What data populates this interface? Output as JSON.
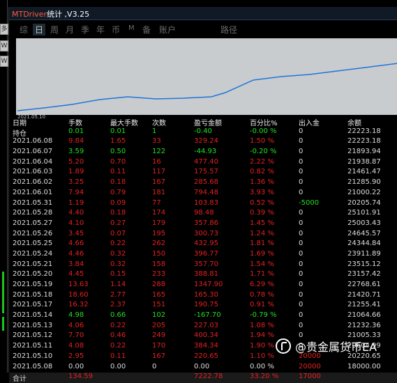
{
  "window": {
    "title_prefix": "MTDriver",
    "title_suffix": "统计 ,V3.25"
  },
  "left_strip": {
    "buttons": [
      "多",
      "W",
      "W",
      "?"
    ]
  },
  "tabs": [
    {
      "label": "综",
      "active": false
    },
    {
      "label": "日",
      "active": true
    },
    {
      "label": "周",
      "active": false
    },
    {
      "label": "月",
      "active": false
    },
    {
      "label": "季",
      "active": false
    },
    {
      "label": "年",
      "active": false
    },
    {
      "label": "币",
      "active": false
    },
    {
      "label": "M",
      "active": false
    },
    {
      "label": "备",
      "active": false
    },
    {
      "label": "账户",
      "active": false
    },
    {
      "label": "路径",
      "active": false
    }
  ],
  "equity_chart": {
    "start_label": "2021.05.10",
    "line_color": "#1e74d8",
    "background": "#c9cccf"
  },
  "table": {
    "headers": {
      "date": "日期",
      "lots": "手数",
      "max_lots": "最大手数",
      "count": "次数",
      "pl": "盈亏金额",
      "pct": "百分比%",
      "io": "出入金",
      "balance": "余额"
    },
    "holding": {
      "date": "持仓",
      "lots": "0.01",
      "max_lots": "0.01",
      "count": "1",
      "pl": "-0.40",
      "pct": "-0.00 %",
      "io": "0",
      "balance": "22223.18"
    },
    "rows": [
      {
        "date": "2021.06.08",
        "lots": "9.84",
        "max_lots": "1.65",
        "count": "33",
        "pl": "329.24",
        "pct": "1.50 %",
        "io": "0",
        "balance": "22223.18",
        "tone": "red"
      },
      {
        "date": "2021.06.07",
        "lots": "3.59",
        "max_lots": "0.50",
        "count": "122",
        "pl": "-44.93",
        "pct": "-0.20 %",
        "io": "0",
        "balance": "21893.94",
        "tone": "green"
      },
      {
        "date": "2021.06.04",
        "lots": "5.20",
        "max_lots": "0.70",
        "count": "16",
        "pl": "477.40",
        "pct": "2.22 %",
        "io": "0",
        "balance": "21938.87",
        "tone": "red"
      },
      {
        "date": "2021.06.03",
        "lots": "1.89",
        "max_lots": "0.11",
        "count": "117",
        "pl": "175.57",
        "pct": "0.82 %",
        "io": "0",
        "balance": "21461.47",
        "tone": "red"
      },
      {
        "date": "2021.06.02",
        "lots": "3.25",
        "max_lots": "0.18",
        "count": "167",
        "pl": "285.68",
        "pct": "1.36 %",
        "io": "0",
        "balance": "21285.90",
        "tone": "red"
      },
      {
        "date": "2021.06.01",
        "lots": "7.94",
        "max_lots": "0.79",
        "count": "181",
        "pl": "794.48",
        "pct": "3.93 %",
        "io": "0",
        "balance": "21000.22",
        "tone": "red"
      },
      {
        "date": "2021.05.31",
        "lots": "1.19",
        "max_lots": "0.09",
        "count": "77",
        "pl": "103.83",
        "pct": "0.52 %",
        "io": "-5000",
        "balance": "20205.74",
        "tone": "red",
        "io_tone": "green"
      },
      {
        "date": "2021.05.28",
        "lots": "4.40",
        "max_lots": "0.18",
        "count": "174",
        "pl": "98.48",
        "pct": "0.39 %",
        "io": "0",
        "balance": "25101.91",
        "tone": "red"
      },
      {
        "date": "2021.05.27",
        "lots": "4.10",
        "max_lots": "0.27",
        "count": "179",
        "pl": "357.86",
        "pct": "1.45 %",
        "io": "0",
        "balance": "25003.43",
        "tone": "red"
      },
      {
        "date": "2021.05.26",
        "lots": "3.45",
        "max_lots": "0.07",
        "count": "195",
        "pl": "300.73",
        "pct": "1.24 %",
        "io": "0",
        "balance": "24645.57",
        "tone": "red"
      },
      {
        "date": "2021.05.25",
        "lots": "4.66",
        "max_lots": "0.22",
        "count": "262",
        "pl": "432.95",
        "pct": "1.81 %",
        "io": "0",
        "balance": "24344.84",
        "tone": "red"
      },
      {
        "date": "2021.05.24",
        "lots": "4.46",
        "max_lots": "0.32",
        "count": "150",
        "pl": "396.77",
        "pct": "1.69 %",
        "io": "0",
        "balance": "23911.89",
        "tone": "red"
      },
      {
        "date": "2021.05.21",
        "lots": "3.84",
        "max_lots": "0.32",
        "count": "158",
        "pl": "357.70",
        "pct": "1.54 %",
        "io": "0",
        "balance": "23515.12",
        "tone": "red"
      },
      {
        "date": "2021.05.20",
        "lots": "4.45",
        "max_lots": "0.15",
        "count": "233",
        "pl": "388.81",
        "pct": "1.71 %",
        "io": "0",
        "balance": "23157.42",
        "tone": "red"
      },
      {
        "date": "2021.05.19",
        "lots": "13.63",
        "max_lots": "1.14",
        "count": "288",
        "pl": "1347.90",
        "pct": "6.29 %",
        "io": "0",
        "balance": "22768.61",
        "tone": "red"
      },
      {
        "date": "2021.05.18",
        "lots": "18.60",
        "max_lots": "2.77",
        "count": "165",
        "pl": "165.30",
        "pct": "0.78 %",
        "io": "0",
        "balance": "21420.71",
        "tone": "red"
      },
      {
        "date": "2021.05.17",
        "lots": "16.32",
        "max_lots": "2.37",
        "count": "151",
        "pl": "190.75",
        "pct": "0.91 %",
        "io": "0",
        "balance": "21255.41",
        "tone": "red"
      },
      {
        "date": "2021.05.14",
        "lots": "4.98",
        "max_lots": "0.66",
        "count": "102",
        "pl": "-167.70",
        "pct": "-0.79 %",
        "io": "0",
        "balance": "21064.66",
        "tone": "green"
      },
      {
        "date": "2021.05.13",
        "lots": "4.06",
        "max_lots": "0.22",
        "count": "205",
        "pl": "227.03",
        "pct": "1.08 %",
        "io": "0",
        "balance": "21232.36",
        "tone": "red"
      },
      {
        "date": "2021.05.12",
        "lots": "7.70",
        "max_lots": "0.46",
        "count": "249",
        "pl": "400.34",
        "pct": "1.94 %",
        "io": "0",
        "balance": "21005.33",
        "tone": "red"
      },
      {
        "date": "2021.05.11",
        "lots": "4.08",
        "max_lots": "0.22",
        "count": "170",
        "pl": "384.34",
        "pct": "1.90 %",
        "io": "0",
        "balance": "20604.99",
        "tone": "red"
      },
      {
        "date": "2021.05.10",
        "lots": "2.95",
        "max_lots": "0.11",
        "count": "167",
        "pl": "220.65",
        "pct": "1.10 %",
        "io": "20000",
        "balance": "20220.65",
        "tone": "red",
        "io_tone": "red"
      },
      {
        "date": "2021.05.08",
        "lots": "0.00",
        "max_lots": "0.00",
        "count": "0",
        "pl": "0.00",
        "pct": "0.00 %",
        "io": "20000",
        "balance": "18000.00",
        "tone": "white",
        "io_tone": "red"
      }
    ],
    "total": {
      "date": "合计",
      "lots": "134.59",
      "max_lots": "",
      "count": "",
      "pl": "7222.78",
      "pct": "33.20 %",
      "io": "17000",
      "balance": ""
    }
  },
  "watermark": {
    "text": "@贵金属货币EA"
  }
}
